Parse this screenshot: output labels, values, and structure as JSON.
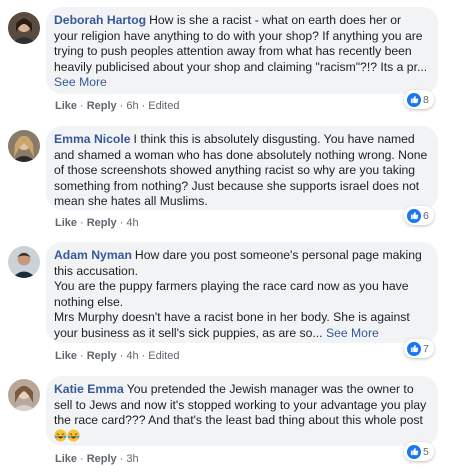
{
  "comments": [
    {
      "author": "Deborah Hartog",
      "avatar_icon": "profile-photo-woman-dark-hair",
      "text": "How is she a racist - what on earth does her or your religion have anything to do with your shop? If anything you are trying to push peoples attention away from what has recently been heavily publicised about your shop and claiming \"racism\"?!? Its a pr...",
      "see_more": "See More",
      "like": "Like",
      "reply": "Reply",
      "time": "6h",
      "edited": "Edited",
      "reaction_count": "8"
    },
    {
      "author": "Emma Nicole",
      "avatar_icon": "profile-photo-woman-blonde",
      "text": "I think this is absolutely disgusting. You have named and shamed a woman who has done absolutely nothing wrong. None of those screenshots showed anything racist so why are you taking something from nothing? Just because she supports israel does not mean she hates all Muslims.",
      "like": "Like",
      "reply": "Reply",
      "time": "4h",
      "reaction_count": "6"
    },
    {
      "author": "Adam Nyman",
      "avatar_icon": "profile-photo-man",
      "text_lines": [
        "How dare you post someone's personal page making this accusation.",
        "You are the puppy farmers playing the race card now as you have nothing else.",
        "Mrs Murphy doesn't have a racist bone in her body. She is against your business as it sell's sick puppies, as are so..."
      ],
      "see_more": "See More",
      "like": "Like",
      "reply": "Reply",
      "time": "4h",
      "edited": "Edited",
      "reaction_count": "7"
    },
    {
      "author": "Katie Emma",
      "avatar_icon": "profile-photo-woman-light",
      "text": "You pretended the Jewish manager was the owner to sell to Jews and now it's stopped working to your advantage you play the race card??? And that's the least bad thing about this whole post",
      "emojis": [
        "laughing-crying-emoji",
        "laughing-crying-emoji"
      ],
      "like": "Like",
      "reply": "Reply",
      "time": "3h",
      "reaction_count": "5"
    }
  ],
  "colors": {
    "author": "#385898",
    "bubble_bg": "#f2f3f5",
    "meta": "#606770",
    "like_blue": "#1877f2"
  }
}
